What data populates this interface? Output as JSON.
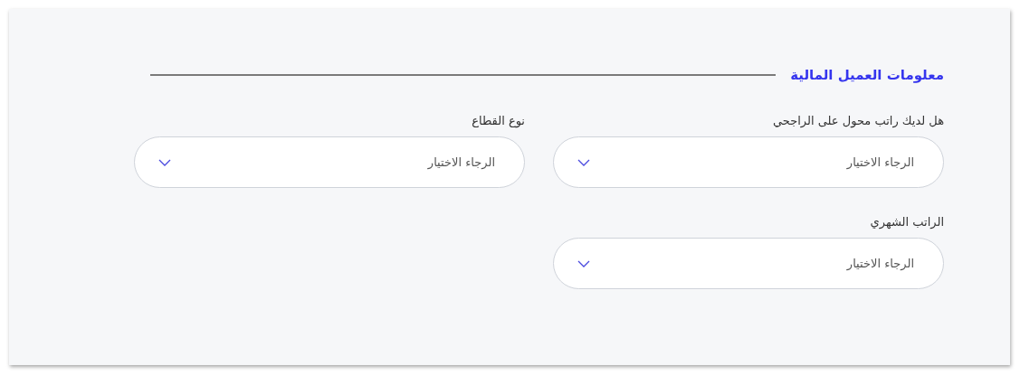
{
  "section": {
    "title": "معلومات العميل المالية"
  },
  "fields": [
    {
      "label": "هل لديك راتب محول على الراجحي",
      "placeholder": "الرجاء الاختيار"
    },
    {
      "label": "نوع القطاع",
      "placeholder": "الرجاء الاختيار"
    },
    {
      "label": "الراتب الشهري",
      "placeholder": "الرجاء الاختيار"
    }
  ]
}
